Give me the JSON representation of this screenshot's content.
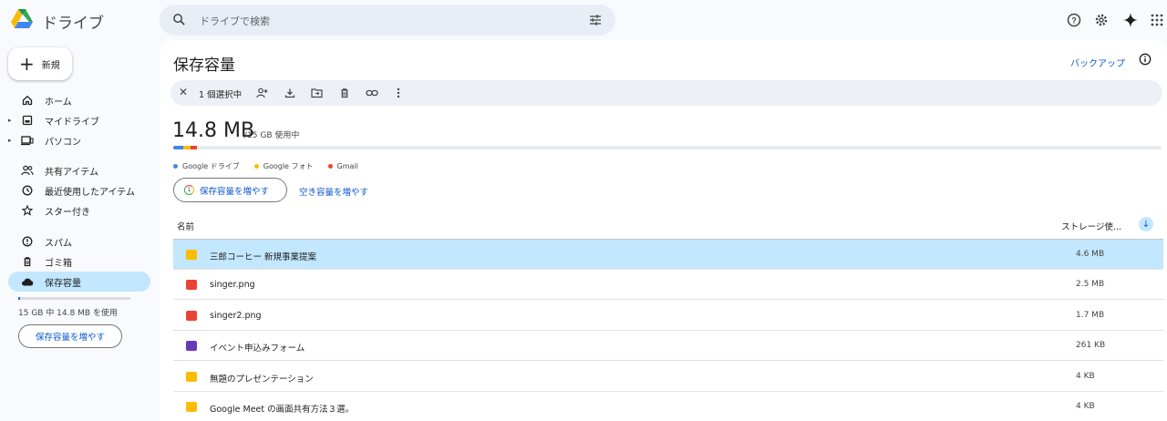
{
  "app": {
    "title": "ドライブ"
  },
  "search": {
    "placeholder": "ドライブで検索"
  },
  "sidebar": {
    "new_label": "新規",
    "items": [
      {
        "label": "ホーム"
      },
      {
        "label": "マイドライブ"
      },
      {
        "label": "パソコン"
      },
      {
        "label": "共有アイテム"
      },
      {
        "label": "最近使用したアイテム"
      },
      {
        "label": "スター付き"
      },
      {
        "label": "スパム"
      },
      {
        "label": "ゴミ箱"
      },
      {
        "label": "保存容量"
      }
    ],
    "quota_text": "15 GB 中 14.8 MB を使用",
    "quota_fraction": 0.001,
    "increase_button": "保存容量を増やす"
  },
  "main": {
    "title": "保存容量",
    "backup_label": "バックアップ",
    "selection": {
      "count_label": "1 個選択中"
    },
    "usage": {
      "amount": "14.8 MB",
      "total": "/15 GB 使用中"
    },
    "legend": [
      {
        "label": "Google ドライブ",
        "color": "#4285f4"
      },
      {
        "label": "Google フォト",
        "color": "#fbbc04"
      },
      {
        "label": "Gmail",
        "color": "#ea4335"
      }
    ],
    "buy_button": "保存容量を増やす",
    "free_link": "空き容量を増やす",
    "columns": {
      "name": "名前",
      "size": "ストレージ使..."
    },
    "files": [
      {
        "name": "三郎コーヒー 新規事業提案",
        "size": "4.6 MB",
        "type": "slides",
        "color": "#fbbc04",
        "selected": true
      },
      {
        "name": "singer.png",
        "size": "2.5 MB",
        "type": "image",
        "color": "#ea4335",
        "selected": false
      },
      {
        "name": "singer2.png",
        "size": "1.7 MB",
        "type": "image",
        "color": "#ea4335",
        "selected": false
      },
      {
        "name": "イベント申込みフォーム",
        "size": "261 KB",
        "type": "forms",
        "color": "#673ab7",
        "selected": false
      },
      {
        "name": "無題のプレゼンテーション",
        "size": "4 KB",
        "type": "slides",
        "color": "#fbbc04",
        "selected": false
      },
      {
        "name": "Google Meet の画面共有方法３選。",
        "size": "4 KB",
        "type": "slides",
        "color": "#fbbc04",
        "selected": false
      }
    ]
  }
}
